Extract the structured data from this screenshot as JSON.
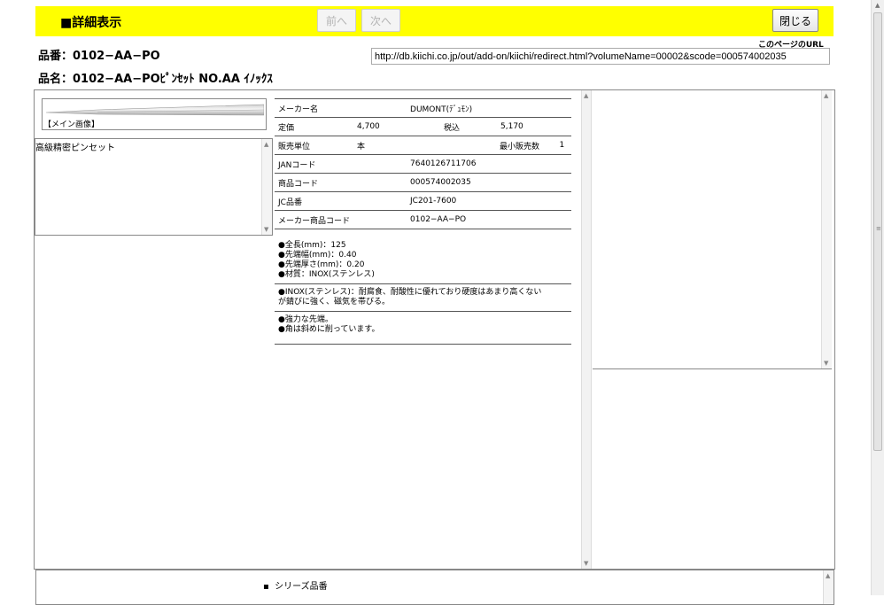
{
  "header": {
    "title": "■詳細表示",
    "prev_label": "前へ",
    "next_label": "次へ",
    "close_label": "閉じる"
  },
  "page_url": {
    "label": "このページのURL",
    "value": "http://db.kiichi.co.jp/out/add-on/kiichi/redirect.html?volumeName=00002&scode=000574002035"
  },
  "product": {
    "number": "品番：0102−AA−PO",
    "name": "品名：0102−AA−POﾋﾟﾝｾｯﾄ NO.AA ｲﾉｯｸｽ"
  },
  "image": {
    "caption": "【メイン画像】"
  },
  "description": "高級精密ピンセット",
  "spec": {
    "maker_label": "メーカー名",
    "maker_value": "DUMONT(ﾃﾞｭﾓﾝ)",
    "price_label": "定価",
    "price_value": "4,700",
    "tax_label": "税込",
    "tax_value": "5,170",
    "unit_label": "販売単位",
    "unit_value": "本",
    "min_label": "最小販売数",
    "min_value": "1",
    "jan_label": "JANコード",
    "jan_value": "7640126711706",
    "code_label": "商品コード",
    "code_value": "000574002035",
    "jc_label": "JC品番",
    "jc_value": "JC201-7600",
    "makercode_label": "メーカー商品コード",
    "makercode_value": "0102−AA−PO"
  },
  "notes": {
    "block1": [
      "●全長(mm)：125",
      "●先端幅(mm)：0.40",
      "●先端厚さ(mm)：0.20",
      "●材質：INOX(ステンレス)"
    ],
    "block2": [
      "●INOX(ステンレス)：耐腐食、耐酸性に優れており硬度はあまり高くない",
      "が錆びに強く、磁気を帯びる。"
    ],
    "block3": [
      "●強力な先端。",
      "●角は斜めに削っています。"
    ]
  },
  "series": {
    "item_label": "シリーズ品番"
  }
}
